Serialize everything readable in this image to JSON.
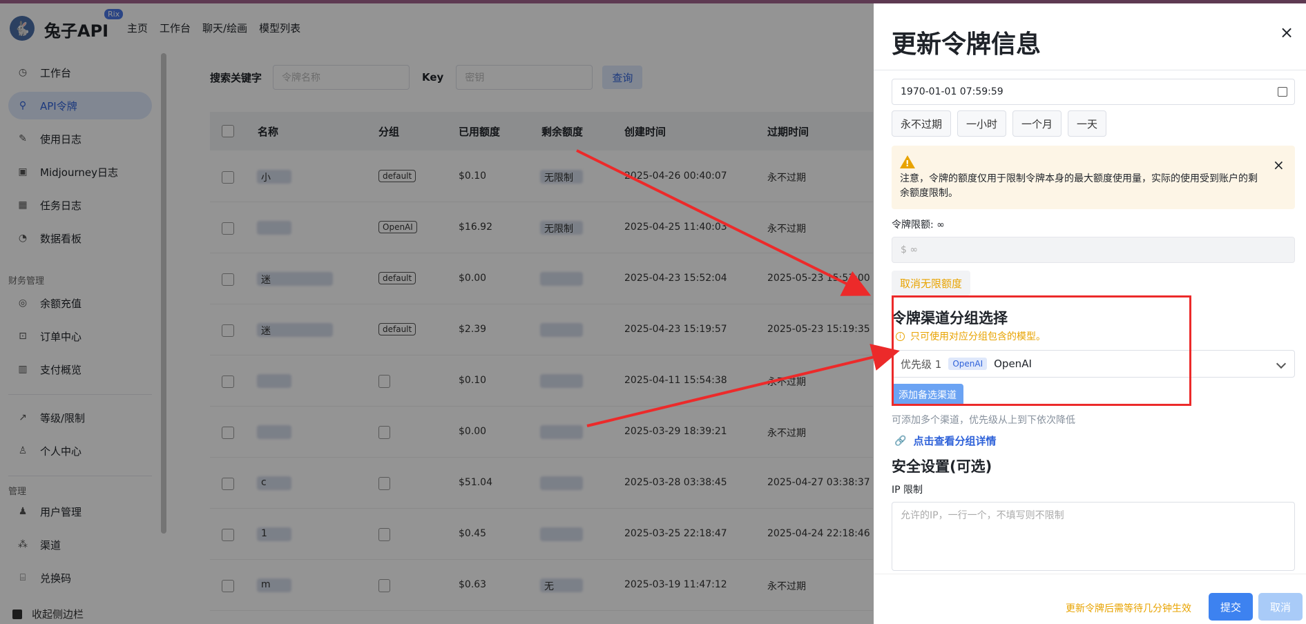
{
  "header": {
    "logo_glyph": "🐇",
    "brand": "兔子API",
    "brand_badge": "Rix",
    "nav": [
      "主页",
      "工作台",
      "聊天/绘画",
      "模型列表"
    ]
  },
  "sidebar": {
    "items": [
      {
        "label": "工作台",
        "icon": "dashboard-icon",
        "glyph": "◷"
      },
      {
        "label": "API令牌",
        "icon": "key-icon",
        "glyph": "⚲"
      },
      {
        "label": "使用日志",
        "icon": "log-icon",
        "glyph": "✎"
      },
      {
        "label": "Midjourney日志",
        "icon": "image-icon",
        "glyph": "▣"
      },
      {
        "label": "任务日志",
        "icon": "task-icon",
        "glyph": "▦"
      },
      {
        "label": "数据看板",
        "icon": "clock-icon",
        "glyph": "◔"
      },
      {
        "label": "余额充值",
        "icon": "coin-icon",
        "glyph": "◎"
      },
      {
        "label": "订单中心",
        "icon": "order-icon",
        "glyph": "⊡"
      },
      {
        "label": "支付概览",
        "icon": "chart-icon",
        "glyph": "▥"
      },
      {
        "label": "等级/限制",
        "icon": "trend-icon",
        "glyph": "↗"
      },
      {
        "label": "个人中心",
        "icon": "user-icon",
        "glyph": "♙"
      },
      {
        "label": "用户管理",
        "icon": "users-icon",
        "glyph": "♟"
      },
      {
        "label": "渠道",
        "icon": "channel-icon",
        "glyph": "⁂"
      },
      {
        "label": "兑换码",
        "icon": "ticket-icon",
        "glyph": "⌸"
      }
    ],
    "sections": [
      "财务管理",
      "管理"
    ],
    "collapse_label": "收起侧边栏"
  },
  "search": {
    "keyword_label": "搜索关键字",
    "keyword_placeholder": "令牌名称",
    "key_label": "Key",
    "key_placeholder": "密钥",
    "query_button": "查询"
  },
  "table": {
    "headers": [
      "名称",
      "分组",
      "已用额度",
      "剩余额度",
      "创建时间",
      "过期时间"
    ],
    "rows": [
      {
        "name": "小",
        "group": "default",
        "used": "$0.10",
        "remain": "无限制",
        "created": "2025-04-26 00:40:07",
        "expire": "永不过期"
      },
      {
        "name": "",
        "group": "OpenAI",
        "used": "$16.92",
        "remain": "无限制",
        "created": "2025-04-25 11:40:03",
        "expire": "永不过期"
      },
      {
        "name": "迷",
        "group": "default",
        "used": "$0.00",
        "remain": "",
        "created": "2025-04-23 15:52:04",
        "expire": "2025-05-23 15:53:00"
      },
      {
        "name": "迷",
        "group": "default",
        "used": "$2.39",
        "remain": "",
        "created": "2025-04-23 15:19:57",
        "expire": "2025-05-23 15:19:35"
      },
      {
        "name": "",
        "group": "",
        "used": "$0.10",
        "remain": "",
        "created": "2025-04-11 15:54:38",
        "expire": "永不过期"
      },
      {
        "name": "",
        "group": "",
        "used": "$0.00",
        "remain": "",
        "created": "2025-03-29 18:39:21",
        "expire": "永不过期"
      },
      {
        "name": "c",
        "group": "",
        "used": "$51.04",
        "remain": "",
        "created": "2025-03-28 03:38:45",
        "expire": "2025-04-27 03:38:37"
      },
      {
        "name": "1",
        "group": "",
        "used": "$0.45",
        "remain": "",
        "created": "2025-03-25 22:18:47",
        "expire": "2025-04-24 22:18:46"
      },
      {
        "name": "m",
        "group": "",
        "used": "$0.63",
        "remain": "无",
        "created": "2025-03-19 11:47:12",
        "expire": "永不过期"
      }
    ]
  },
  "drawer": {
    "title": "更新令牌信息",
    "close_glyph": "×",
    "expire_value": "1970-01-01 07:59:59",
    "quick_buttons": [
      "永不过期",
      "一小时",
      "一个月",
      "一天"
    ],
    "warning": "注意，令牌的额度仅用于限制令牌本身的最大额度使用量，实际的使用受到账户的剩余额度限制。",
    "warning_glyph": "!",
    "limit_label": "令牌限额: ∞",
    "limit_value": "$   ∞",
    "cancel_unlimited": "取消无限额度",
    "channel_section_title": "令牌渠道分组选择",
    "channel_note": "只可使用对应分组包含的模型。",
    "channel_note_glyph": "i",
    "priority_label": "优先级 1",
    "channel_tag": "OpenAI",
    "channel_name": "OpenAI",
    "add_channel_button": "添加备选渠道",
    "add_hint": "可添加多个渠道，优先级从上到下依次降低",
    "detail_link": "点击查看分组详情",
    "link_glyph": "🔗",
    "security_title": "安全设置(可选)",
    "ip_label": "IP 限制",
    "ip_placeholder": "允许的IP，一行一个，不填写则不限制",
    "footer_note": "更新令牌后需等待几分钟生效",
    "submit": "提交",
    "cancel": "取消"
  },
  "colors": {
    "highlight": "#ec2a2a",
    "primary": "#3d82f0",
    "warning": "#e8a300"
  }
}
